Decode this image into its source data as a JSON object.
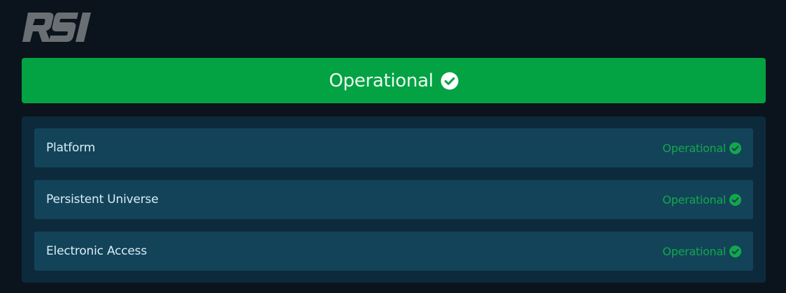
{
  "brand": {
    "logo_text": "RSI",
    "logo_color": "#6a6f73"
  },
  "overall_status": {
    "label": "Operational",
    "icon": "check-circle-icon",
    "color": "#03a243"
  },
  "components": [
    {
      "name": "Platform",
      "status": "Operational",
      "icon": "check-circle-icon"
    },
    {
      "name": "Persistent Universe",
      "status": "Operational",
      "icon": "check-circle-icon"
    },
    {
      "name": "Electronic Access",
      "status": "Operational",
      "icon": "check-circle-icon"
    }
  ],
  "colors": {
    "background": "#0b141d",
    "panel": "#0d2a3d",
    "row": "#134359",
    "status_green": "#12a84a"
  }
}
